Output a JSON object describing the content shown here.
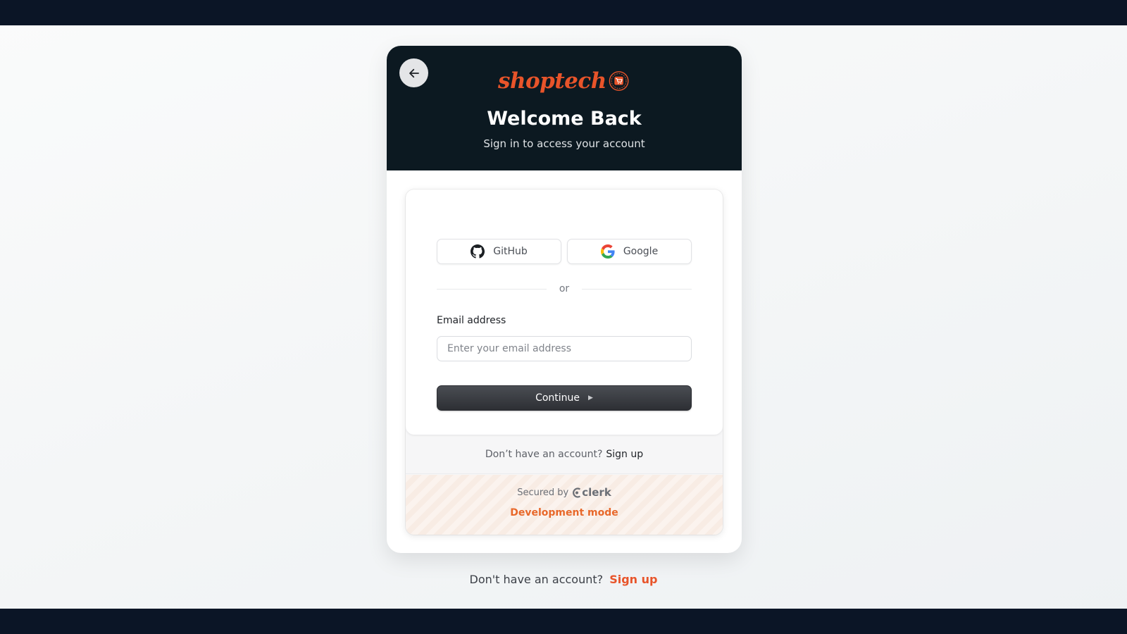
{
  "brand": {
    "logo_text": "shoptech",
    "accent_color": "#e8542a",
    "header_bg": "#0c1921"
  },
  "header": {
    "back_icon": "arrow-left-icon",
    "title": "Welcome Back",
    "subtitle": "Sign in to access your account"
  },
  "sign_in": {
    "social": [
      {
        "label": "GitHub",
        "icon": "github-icon"
      },
      {
        "label": "Google",
        "icon": "google-icon"
      }
    ],
    "divider_text": "or",
    "email": {
      "label": "Email address",
      "placeholder": "Enter your email address",
      "value": ""
    },
    "continue_label": "Continue",
    "continue_icon": "play-triangle-icon",
    "footer": {
      "prompt": "Don’t have an account?",
      "link": "Sign up"
    },
    "secured_by": "Secured by",
    "provider": "clerk",
    "dev_mode": "Development mode"
  },
  "page_footer": {
    "prompt": "Don't have an account?",
    "link": "Sign up"
  }
}
